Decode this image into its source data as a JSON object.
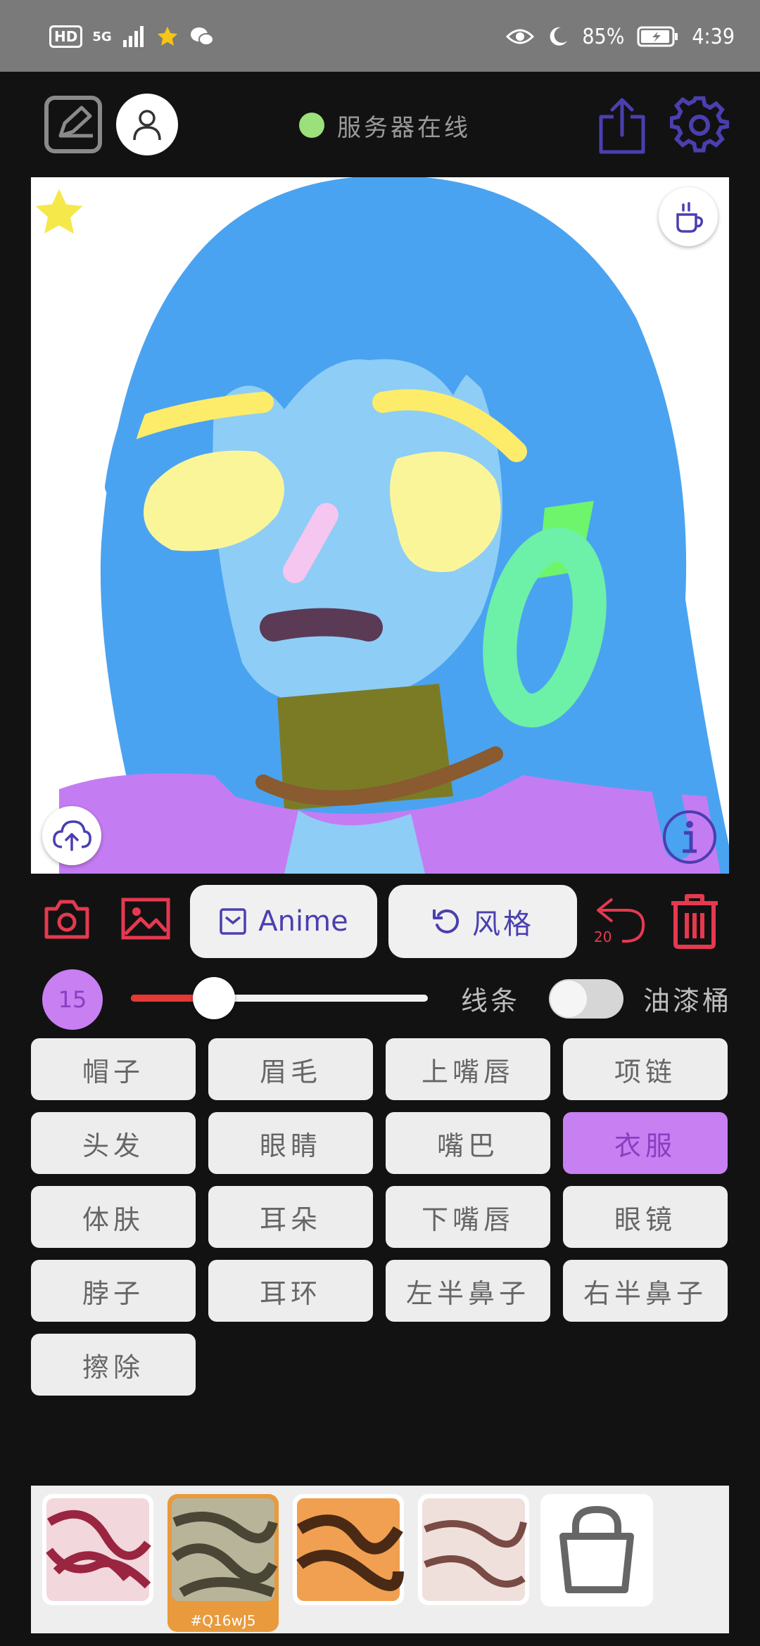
{
  "status_bar": {
    "hd": "HD",
    "network": "5G",
    "battery_percent": "85%",
    "time": "4:39"
  },
  "toolbar": {
    "server_status": "服务器在线"
  },
  "actions": {
    "anime_label": "Anime",
    "style_label": "风格",
    "undo_count": "20"
  },
  "brush": {
    "size": "15",
    "slider_fraction": 0.28,
    "line_label": "线条",
    "bucket_label": "油漆桶",
    "bucket_enabled": false
  },
  "parts": [
    {
      "label": "帽子"
    },
    {
      "label": "眉毛"
    },
    {
      "label": "上嘴唇"
    },
    {
      "label": "项链"
    },
    {
      "label": "头发"
    },
    {
      "label": "眼睛"
    },
    {
      "label": "嘴巴"
    },
    {
      "label": "衣服",
      "active": true
    },
    {
      "label": "体肤"
    },
    {
      "label": "耳朵"
    },
    {
      "label": "下嘴唇"
    },
    {
      "label": "眼镜"
    },
    {
      "label": "脖子"
    },
    {
      "label": "耳环"
    },
    {
      "label": "左半鼻子"
    },
    {
      "label": "右半鼻子"
    },
    {
      "label": "擦除"
    }
  ],
  "style_thumbnails": {
    "selected_caption": "#Q16wJ5"
  },
  "colors": {
    "accent_purple": "#c77ff2",
    "icon_blue": "#4a3fb0",
    "danger_red": "#e53935",
    "online_green": "#9be07a"
  }
}
